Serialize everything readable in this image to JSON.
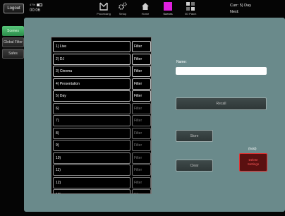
{
  "topbar": {
    "logout_label": "Logout",
    "battery_text": "47%",
    "battery_level": 0.47,
    "clock": "00:06",
    "tabs": [
      {
        "label": "Processing",
        "icon": "processing-icon",
        "active": false
      },
      {
        "label": "Setup",
        "icon": "gears-icon",
        "active": false
      },
      {
        "label": "Home",
        "icon": "home-icon",
        "active": false
      },
      {
        "label": "Scenes",
        "icon": "scenes-icon",
        "active": true
      },
      {
        "label": "I/O Patch",
        "icon": "patch-grid-icon",
        "active": false
      }
    ],
    "current_label": "Curr: 5) Day",
    "next_label": "Next:"
  },
  "sidebar": {
    "items": [
      {
        "label": "Scenes",
        "active": true
      },
      {
        "label": "Global Filter",
        "active": false
      },
      {
        "label": "Safes",
        "active": false
      }
    ]
  },
  "scenes": {
    "filter_label": "Filter",
    "rows": [
      {
        "label": "1) Live",
        "filled": true
      },
      {
        "label": "2) DJ",
        "filled": true
      },
      {
        "label": "3) Cinema",
        "filled": true
      },
      {
        "label": "4) Presentation",
        "filled": true
      },
      {
        "label": "5) Day",
        "filled": true
      },
      {
        "label": "6)",
        "filled": false
      },
      {
        "label": "7)",
        "filled": false
      },
      {
        "label": "8)",
        "filled": false
      },
      {
        "label": "9)",
        "filled": false
      },
      {
        "label": "10)",
        "filled": false
      },
      {
        "label": "11)",
        "filled": false
      },
      {
        "label": "12)",
        "filled": false
      },
      {
        "label": "13)",
        "filled": false
      }
    ]
  },
  "controls": {
    "name_label": "Name:",
    "name_value": "",
    "recall_label": "Recall",
    "store_label": "Store",
    "clear_label": "Clear",
    "hold_label": "(hold)",
    "delete_line1": "Delete",
    "delete_line2": "Settings"
  },
  "colors": {
    "panel": "#6a8a8b",
    "active_tab": "#3fa862",
    "scenes_tab_active": "#e020e0",
    "delete_border": "#e03030"
  }
}
